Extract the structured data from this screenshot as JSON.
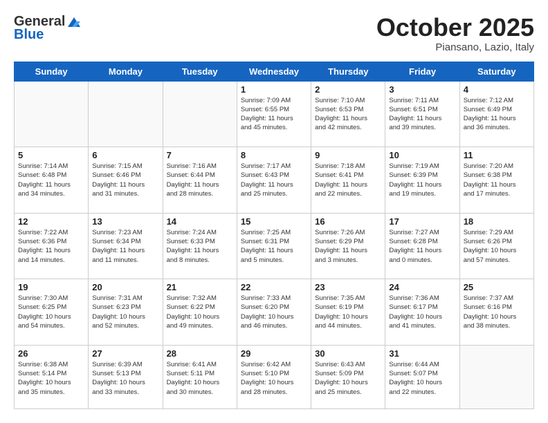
{
  "header": {
    "logo_general": "General",
    "logo_blue": "Blue",
    "month_title": "October 2025",
    "subtitle": "Piansano, Lazio, Italy"
  },
  "days_of_week": [
    "Sunday",
    "Monday",
    "Tuesday",
    "Wednesday",
    "Thursday",
    "Friday",
    "Saturday"
  ],
  "weeks": [
    [
      {
        "day": "",
        "info": ""
      },
      {
        "day": "",
        "info": ""
      },
      {
        "day": "",
        "info": ""
      },
      {
        "day": "1",
        "info": "Sunrise: 7:09 AM\nSunset: 6:55 PM\nDaylight: 11 hours\nand 45 minutes."
      },
      {
        "day": "2",
        "info": "Sunrise: 7:10 AM\nSunset: 6:53 PM\nDaylight: 11 hours\nand 42 minutes."
      },
      {
        "day": "3",
        "info": "Sunrise: 7:11 AM\nSunset: 6:51 PM\nDaylight: 11 hours\nand 39 minutes."
      },
      {
        "day": "4",
        "info": "Sunrise: 7:12 AM\nSunset: 6:49 PM\nDaylight: 11 hours\nand 36 minutes."
      }
    ],
    [
      {
        "day": "5",
        "info": "Sunrise: 7:14 AM\nSunset: 6:48 PM\nDaylight: 11 hours\nand 34 minutes."
      },
      {
        "day": "6",
        "info": "Sunrise: 7:15 AM\nSunset: 6:46 PM\nDaylight: 11 hours\nand 31 minutes."
      },
      {
        "day": "7",
        "info": "Sunrise: 7:16 AM\nSunset: 6:44 PM\nDaylight: 11 hours\nand 28 minutes."
      },
      {
        "day": "8",
        "info": "Sunrise: 7:17 AM\nSunset: 6:43 PM\nDaylight: 11 hours\nand 25 minutes."
      },
      {
        "day": "9",
        "info": "Sunrise: 7:18 AM\nSunset: 6:41 PM\nDaylight: 11 hours\nand 22 minutes."
      },
      {
        "day": "10",
        "info": "Sunrise: 7:19 AM\nSunset: 6:39 PM\nDaylight: 11 hours\nand 19 minutes."
      },
      {
        "day": "11",
        "info": "Sunrise: 7:20 AM\nSunset: 6:38 PM\nDaylight: 11 hours\nand 17 minutes."
      }
    ],
    [
      {
        "day": "12",
        "info": "Sunrise: 7:22 AM\nSunset: 6:36 PM\nDaylight: 11 hours\nand 14 minutes."
      },
      {
        "day": "13",
        "info": "Sunrise: 7:23 AM\nSunset: 6:34 PM\nDaylight: 11 hours\nand 11 minutes."
      },
      {
        "day": "14",
        "info": "Sunrise: 7:24 AM\nSunset: 6:33 PM\nDaylight: 11 hours\nand 8 minutes."
      },
      {
        "day": "15",
        "info": "Sunrise: 7:25 AM\nSunset: 6:31 PM\nDaylight: 11 hours\nand 5 minutes."
      },
      {
        "day": "16",
        "info": "Sunrise: 7:26 AM\nSunset: 6:29 PM\nDaylight: 11 hours\nand 3 minutes."
      },
      {
        "day": "17",
        "info": "Sunrise: 7:27 AM\nSunset: 6:28 PM\nDaylight: 11 hours\nand 0 minutes."
      },
      {
        "day": "18",
        "info": "Sunrise: 7:29 AM\nSunset: 6:26 PM\nDaylight: 10 hours\nand 57 minutes."
      }
    ],
    [
      {
        "day": "19",
        "info": "Sunrise: 7:30 AM\nSunset: 6:25 PM\nDaylight: 10 hours\nand 54 minutes."
      },
      {
        "day": "20",
        "info": "Sunrise: 7:31 AM\nSunset: 6:23 PM\nDaylight: 10 hours\nand 52 minutes."
      },
      {
        "day": "21",
        "info": "Sunrise: 7:32 AM\nSunset: 6:22 PM\nDaylight: 10 hours\nand 49 minutes."
      },
      {
        "day": "22",
        "info": "Sunrise: 7:33 AM\nSunset: 6:20 PM\nDaylight: 10 hours\nand 46 minutes."
      },
      {
        "day": "23",
        "info": "Sunrise: 7:35 AM\nSunset: 6:19 PM\nDaylight: 10 hours\nand 44 minutes."
      },
      {
        "day": "24",
        "info": "Sunrise: 7:36 AM\nSunset: 6:17 PM\nDaylight: 10 hours\nand 41 minutes."
      },
      {
        "day": "25",
        "info": "Sunrise: 7:37 AM\nSunset: 6:16 PM\nDaylight: 10 hours\nand 38 minutes."
      }
    ],
    [
      {
        "day": "26",
        "info": "Sunrise: 6:38 AM\nSunset: 5:14 PM\nDaylight: 10 hours\nand 35 minutes."
      },
      {
        "day": "27",
        "info": "Sunrise: 6:39 AM\nSunset: 5:13 PM\nDaylight: 10 hours\nand 33 minutes."
      },
      {
        "day": "28",
        "info": "Sunrise: 6:41 AM\nSunset: 5:11 PM\nDaylight: 10 hours\nand 30 minutes."
      },
      {
        "day": "29",
        "info": "Sunrise: 6:42 AM\nSunset: 5:10 PM\nDaylight: 10 hours\nand 28 minutes."
      },
      {
        "day": "30",
        "info": "Sunrise: 6:43 AM\nSunset: 5:09 PM\nDaylight: 10 hours\nand 25 minutes."
      },
      {
        "day": "31",
        "info": "Sunrise: 6:44 AM\nSunset: 5:07 PM\nDaylight: 10 hours\nand 22 minutes."
      },
      {
        "day": "",
        "info": ""
      }
    ]
  ]
}
